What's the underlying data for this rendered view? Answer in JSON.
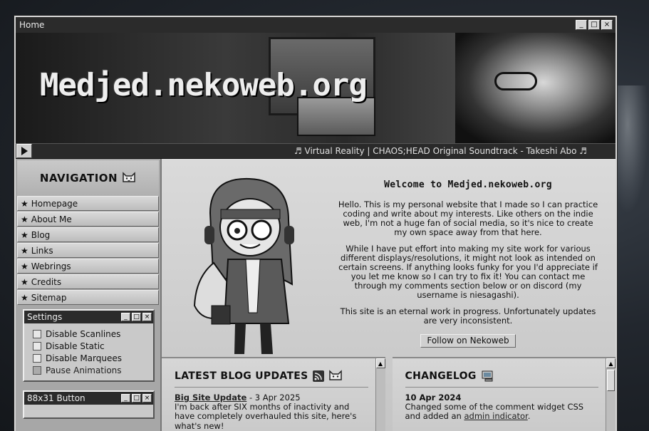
{
  "window": {
    "title": "Home",
    "controls": [
      "_",
      "□",
      "×"
    ]
  },
  "banner": {
    "logo_text": "Medjed.nekoweb.org"
  },
  "music": {
    "now_playing": "♬ Virtual Reality | CHAOS;HEAD Original Soundtrack - Takeshi Abo ♬"
  },
  "sidebar": {
    "nav_heading": "NAVIGATION",
    "items": [
      {
        "label": "Homepage"
      },
      {
        "label": "About Me"
      },
      {
        "label": "Blog"
      },
      {
        "label": "Links"
      },
      {
        "label": "Webrings"
      },
      {
        "label": "Credits"
      },
      {
        "label": "Sitemap"
      }
    ],
    "settings": {
      "title": "Settings",
      "options": [
        {
          "label": "Disable Scanlines"
        },
        {
          "label": "Disable Static"
        },
        {
          "label": "Disable Marquees"
        },
        {
          "label": "Pause Animations"
        }
      ]
    },
    "button_window": {
      "title": "88x31 Button"
    }
  },
  "welcome": {
    "title": "Welcome to Medjed.nekoweb.org",
    "p1": "Hello. This is my personal website that I made so I can practice coding and write about my interests. Like others on the indie web, I'm not a huge fan of social media, so it's nice to create my own space away from that here.",
    "p2": "While I have put effort into making my site work for various different displays/resolutions, it might not look as intended on certain screens. If anything looks funky for you I'd appreciate if you let me know so I can try to fix it! You can contact me through my comments section below or on discord (my username is niesagashi).",
    "p3": "This site is an eternal work in progress. Unfortunately updates are very inconsistent.",
    "follow_button": "Follow on Nekoweb"
  },
  "blog": {
    "heading": "LATEST BLOG UPDATES",
    "entry_title": "Big Site Update",
    "entry_date": " - 3 Apr 2025",
    "entry_text": "I'm back after SIX months of inactivity and have completely overhauled this site, here's what's new!"
  },
  "changelog": {
    "heading": "CHANGELOG",
    "entry_date": "10 Apr 2024",
    "entry_text": "Changed some of the comment widget CSS and added an ",
    "entry_link": "admin indicator",
    "entry_end": "."
  }
}
